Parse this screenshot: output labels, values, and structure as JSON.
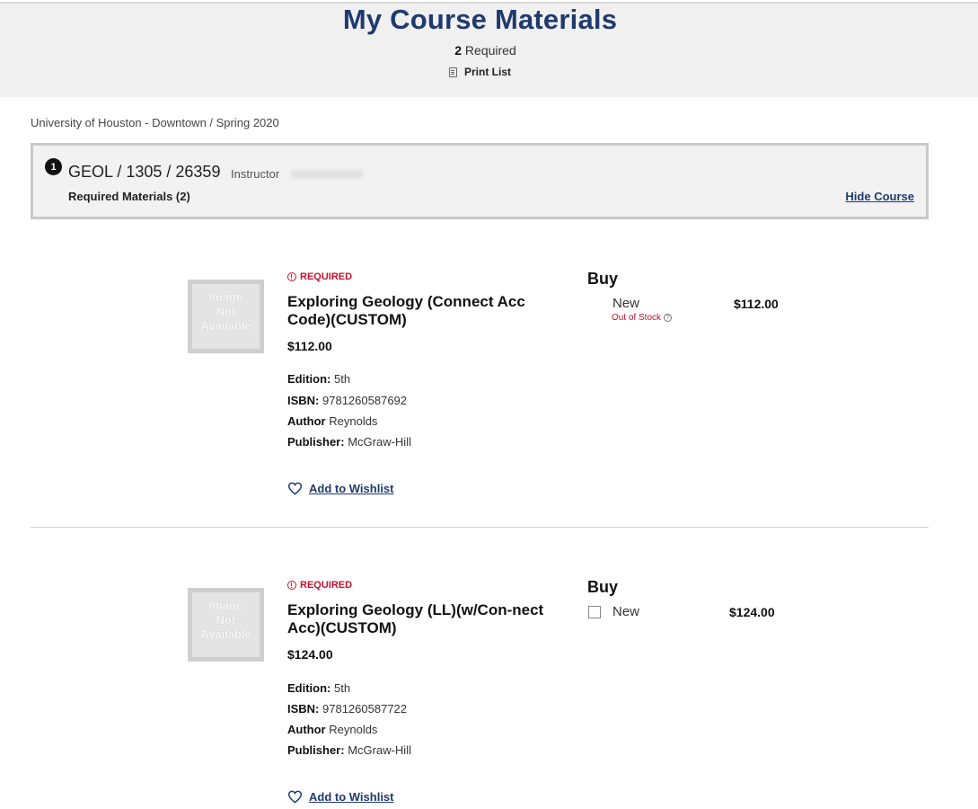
{
  "header": {
    "title": "My Course Materials",
    "required_count": "2",
    "required_label": "Required",
    "print_label": "Print List"
  },
  "breadcrumb": "University of Houston - Downtown / Spring 2020",
  "course": {
    "number": "1",
    "code": "GEOL / 1305 / 26359",
    "instructor_label": "Instructor",
    "required_materials": "Required Materials (2)",
    "hide_label": "Hide Course"
  },
  "products": [
    {
      "image_text": [
        "Image",
        "Not",
        "Available"
      ],
      "tag": "REQUIRED",
      "title": "Exploring Geology (Connect Acc Code)(CUSTOM)",
      "price": "$112.00",
      "edition_label": "Edition:",
      "edition": "5th",
      "isbn_label": "ISBN:",
      "isbn": "9781260587692",
      "author_label": "Author",
      "author": "Reynolds",
      "publisher_label": "Publisher:",
      "publisher": "McGraw-Hill",
      "wishlist": "Add to Wishlist",
      "buy_label": "Buy",
      "option": {
        "condition": "New",
        "stock": "Out of Stock",
        "stock_icon": "?",
        "price": "$112.00"
      }
    },
    {
      "image_text": [
        "Image",
        "Not",
        "Available"
      ],
      "tag": "REQUIRED",
      "title": "Exploring Geology (LL)(w/Con-nect Acc)(CUSTOM)",
      "price": "$124.00",
      "edition_label": "Edition:",
      "edition": "5th",
      "isbn_label": "ISBN:",
      "isbn": "9781260587722",
      "author_label": "Author",
      "author": "Reynolds",
      "publisher_label": "Publisher:",
      "publisher": "McGraw-Hill",
      "wishlist": "Add to Wishlist",
      "buy_label": "Buy",
      "option": {
        "condition": "New",
        "price": "$124.00"
      }
    }
  ],
  "colors": {
    "brand_navy": "#1f3a6e",
    "required_red": "#c8102e",
    "header_bg": "#f0f0f0"
  }
}
